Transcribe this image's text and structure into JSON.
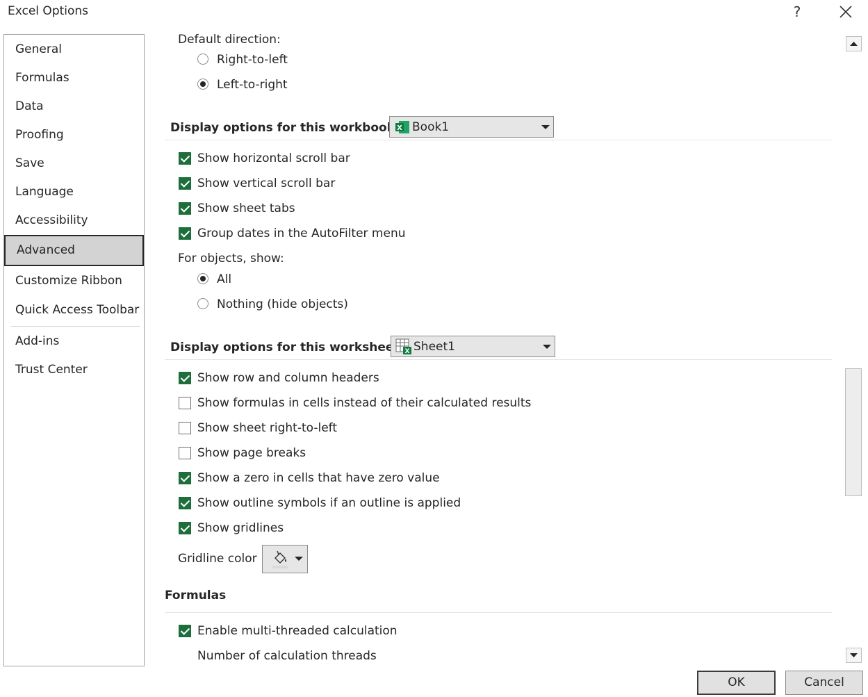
{
  "window": {
    "title": "Excel Options",
    "help": "?",
    "close": "✕"
  },
  "sidebar": {
    "items": [
      "General",
      "Formulas",
      "Data",
      "Proofing",
      "Save",
      "Language",
      "Accessibility",
      "Advanced",
      "Customize Ribbon",
      "Quick Access Toolbar",
      "Add-ins",
      "Trust Center"
    ],
    "selected": "Advanced"
  },
  "direction": {
    "label": "Default direction:",
    "options": [
      {
        "label": "Right-to-left",
        "checked": false
      },
      {
        "label": "Left-to-right",
        "checked": true
      }
    ]
  },
  "workbook": {
    "header": "Display options for this workbook:",
    "dropdown_value": "Book1",
    "checks": [
      {
        "label": "Show horizontal scroll bar",
        "checked": true
      },
      {
        "label": "Show vertical scroll bar",
        "checked": true
      },
      {
        "label": "Show sheet tabs",
        "checked": true
      },
      {
        "label": "Group dates in the AutoFilter menu",
        "checked": true
      }
    ],
    "objects_label": "For objects, show:",
    "objects_options": [
      {
        "label": "All",
        "checked": true
      },
      {
        "label": "Nothing (hide objects)",
        "checked": false
      }
    ]
  },
  "worksheet": {
    "header": "Display options for this worksheet:",
    "dropdown_value": "Sheet1",
    "checks": [
      {
        "label": "Show row and column headers",
        "checked": true
      },
      {
        "label": "Show formulas in cells instead of their calculated results",
        "checked": false
      },
      {
        "label": "Show sheet right-to-left",
        "checked": false
      },
      {
        "label": "Show page breaks",
        "checked": false
      },
      {
        "label": "Show a zero in cells that have zero value",
        "checked": true
      },
      {
        "label": "Show outline symbols if an outline is applied",
        "checked": true
      },
      {
        "label": "Show gridlines",
        "checked": true
      }
    ],
    "gridline_color_label": "Gridline color"
  },
  "formulas": {
    "header": "Formulas",
    "checks": [
      {
        "label": "Enable multi-threaded calculation",
        "checked": true
      }
    ],
    "threads_label": "Number of calculation threads"
  },
  "buttons": {
    "ok": "OK",
    "cancel": "Cancel"
  },
  "colors": {
    "accent_check": "#1e6e3c",
    "selected_nav": "#d3d3d3",
    "excel_green": "#107c41"
  }
}
